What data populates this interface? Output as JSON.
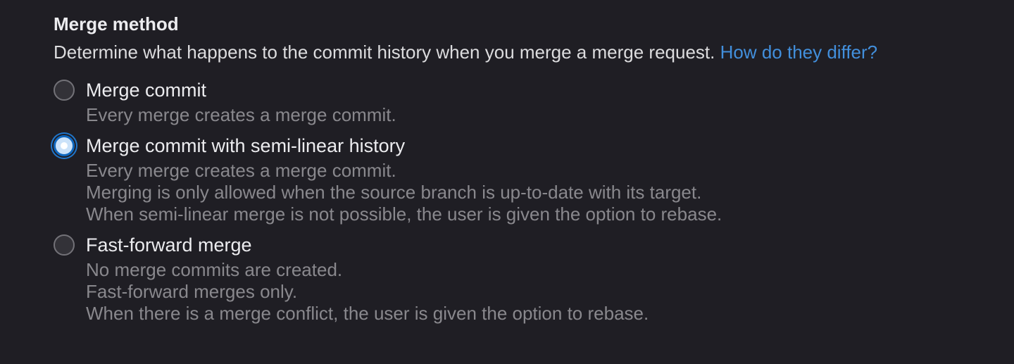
{
  "section": {
    "title": "Merge method",
    "description": "Determine what happens to the commit history when you merge a merge request.",
    "help_link": "How do they differ?"
  },
  "options": [
    {
      "label": "Merge commit",
      "checked": false,
      "help": [
        "Every merge creates a merge commit."
      ]
    },
    {
      "label": "Merge commit with semi-linear history",
      "checked": true,
      "help": [
        "Every merge creates a merge commit.",
        "Merging is only allowed when the source branch is up-to-date with its target.",
        "When semi-linear merge is not possible, the user is given the option to rebase."
      ]
    },
    {
      "label": "Fast-forward merge",
      "checked": false,
      "help": [
        "No merge commits are created.",
        "Fast-forward merges only.",
        "When there is a merge conflict, the user is given the option to rebase."
      ]
    }
  ],
  "colors": {
    "background": "#1f1e24",
    "link": "#428fdc",
    "help_text": "#89888d",
    "radio_checked": "#1068bf"
  }
}
